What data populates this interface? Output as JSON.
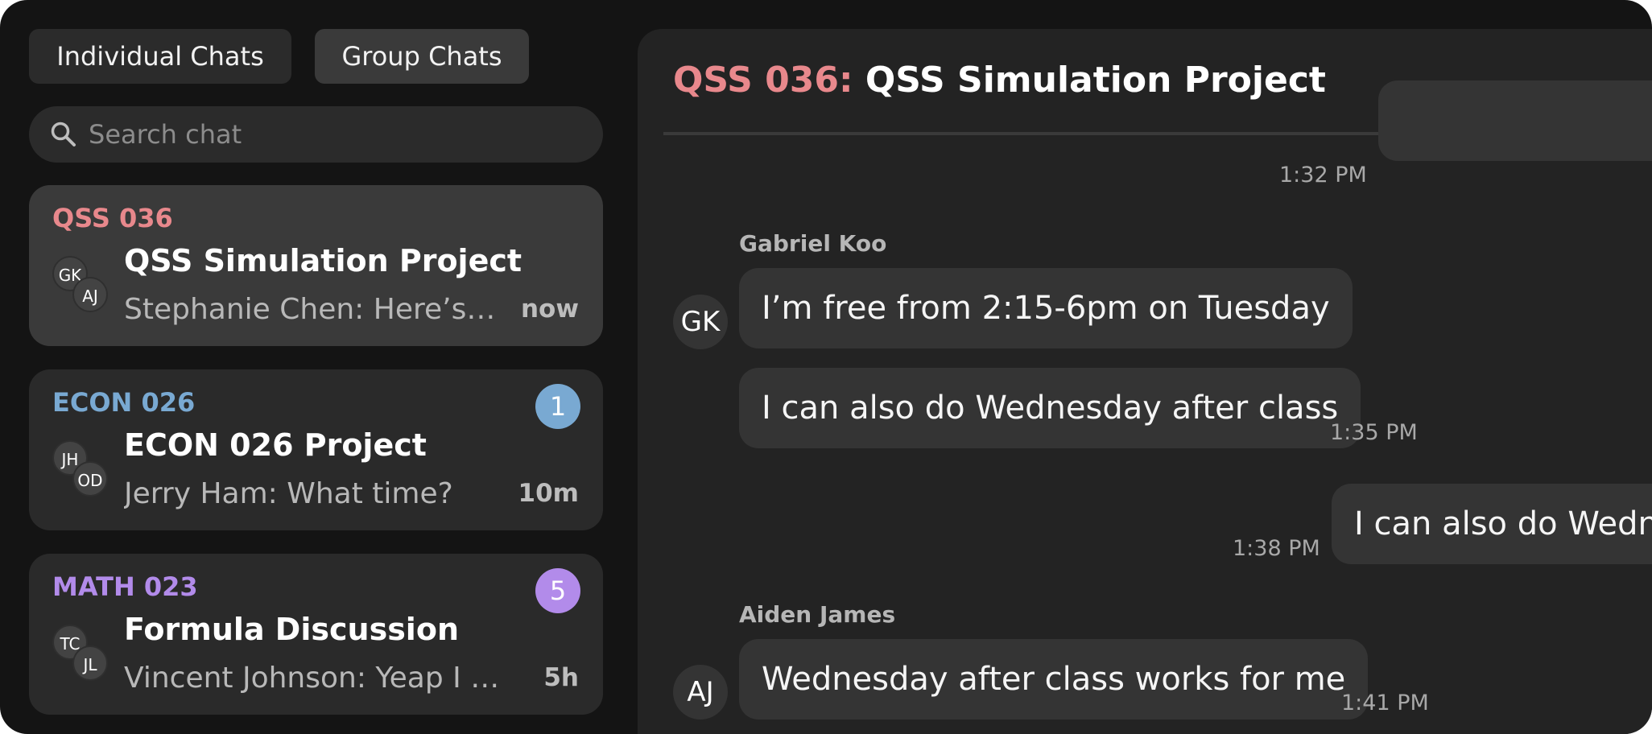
{
  "tabs": {
    "individual_label": "Individual Chats",
    "group_label": "Group Chats"
  },
  "search": {
    "placeholder": "Search chat",
    "icon": "search-icon"
  },
  "chats": [
    {
      "course": "QSS 036",
      "course_color": "#e8888c",
      "title": "QSS Simulation Project",
      "preview": "Stephanie Chen: Here’s the updated plan",
      "time": "now",
      "badge": "",
      "avatars": [
        "GK",
        "AJ"
      ],
      "active": true
    },
    {
      "course": "ECON 026",
      "course_color": "#79a9d2",
      "title": "ECON 026 Project",
      "preview": "Jerry Ham: What time?",
      "time": "10m",
      "badge": "1",
      "badge_color": "#79a9d2",
      "avatars": [
        "JH",
        "OD"
      ]
    },
    {
      "course": "MATH 023",
      "course_color": "#b28bea",
      "title": "Formula Discussion",
      "preview": "Vincent Johnson: Yeap I got it",
      "time": "5h",
      "badge": "5",
      "badge_color": "#b28bea",
      "avatars": [
        "TC",
        "JL"
      ]
    }
  ],
  "conversation": {
    "course": "QSS 036:",
    "title": "QSS Simulation Project",
    "first_timestamp": "1:32 PM",
    "messages": [
      {
        "sender": "Gabriel Koo",
        "avatar": "GK",
        "texts": [
          "I’m free from 2:15-6pm on Tuesday",
          "I can also do Wednesday after class"
        ],
        "time": "1:35 PM"
      },
      {
        "sender": "",
        "self": true,
        "texts": [
          "I can also do Wednesday after class"
        ],
        "time": "1:38 PM"
      },
      {
        "sender": "Aiden James",
        "avatar": "AJ",
        "texts": [
          "Wednesday after class works for me"
        ],
        "time": "1:41 PM"
      }
    ]
  }
}
